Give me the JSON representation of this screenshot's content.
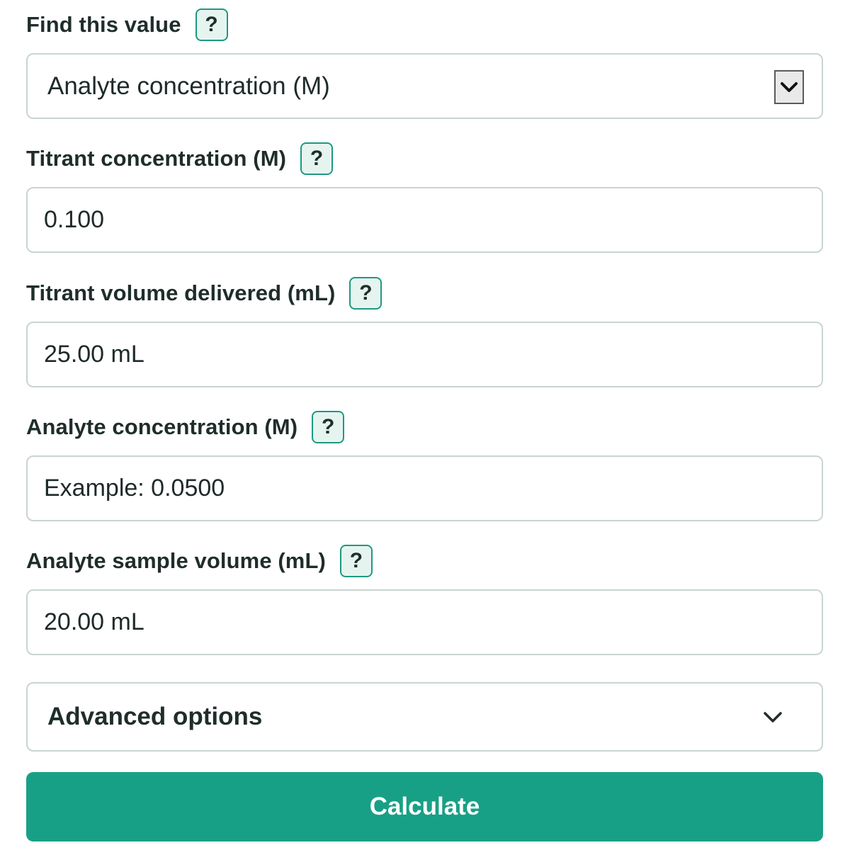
{
  "find_value": {
    "label": "Find this value",
    "help": "?",
    "selected": "Analyte concentration (M)"
  },
  "fields": [
    {
      "label": "Titrant concentration (M)",
      "help": "?",
      "value": "0.100",
      "placeholder": ""
    },
    {
      "label": "Titrant volume delivered (mL)",
      "help": "?",
      "value": "25.00 mL",
      "placeholder": ""
    },
    {
      "label": "Analyte concentration (M)",
      "help": "?",
      "value": "",
      "placeholder": "Example: 0.0500"
    },
    {
      "label": "Analyte sample volume (mL)",
      "help": "?",
      "value": "20.00 mL",
      "placeholder": ""
    }
  ],
  "advanced": {
    "label": "Advanced options",
    "icon": "chevron-down-icon"
  },
  "calculate": {
    "label": "Calculate"
  },
  "colors": {
    "accent": "#18a086",
    "help_background": "#e6f4f0",
    "border": "#c8d5d1",
    "text": "#1f2a2a"
  }
}
